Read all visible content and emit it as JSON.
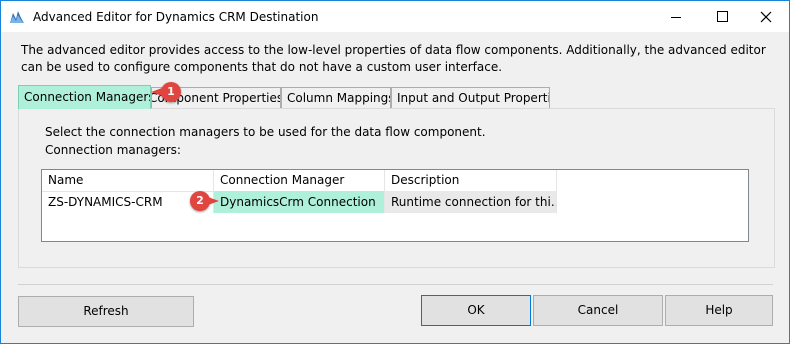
{
  "window": {
    "title": "Advanced Editor for Dynamics CRM Destination",
    "accent_color": "#1883d7"
  },
  "description": "The advanced editor provides access to the low-level properties of data flow components. Additionally, the advanced editor can be used to configure components that do not have a custom user interface.",
  "tabs": [
    {
      "label": "Connection Managers",
      "active": true
    },
    {
      "label": "Component Properties",
      "active": false
    },
    {
      "label": "Column Mappings",
      "active": false
    },
    {
      "label": "Input and Output Properties",
      "active": false
    }
  ],
  "panel": {
    "instruction": "Select the connection managers to be used for the data flow component.",
    "list_label": "Connection managers:"
  },
  "grid": {
    "columns": [
      "Name",
      "Connection Manager",
      "Description"
    ],
    "rows": [
      {
        "name": "ZS-DYNAMICS-CRM",
        "connection_manager": "DynamicsCrm Connection",
        "description": "Runtime connection for thi..."
      }
    ]
  },
  "callouts": [
    {
      "number": "1"
    },
    {
      "number": "2"
    }
  ],
  "buttons": {
    "refresh": "Refresh",
    "ok": "OK",
    "cancel": "Cancel",
    "help": "Help"
  },
  "colors": {
    "highlight": "#aef0d9",
    "callout": "#e0453f"
  },
  "icons": {
    "app": "ssis-component-icon",
    "minimize": "minimize-icon",
    "maximize": "maximize-icon",
    "close": "close-icon"
  }
}
